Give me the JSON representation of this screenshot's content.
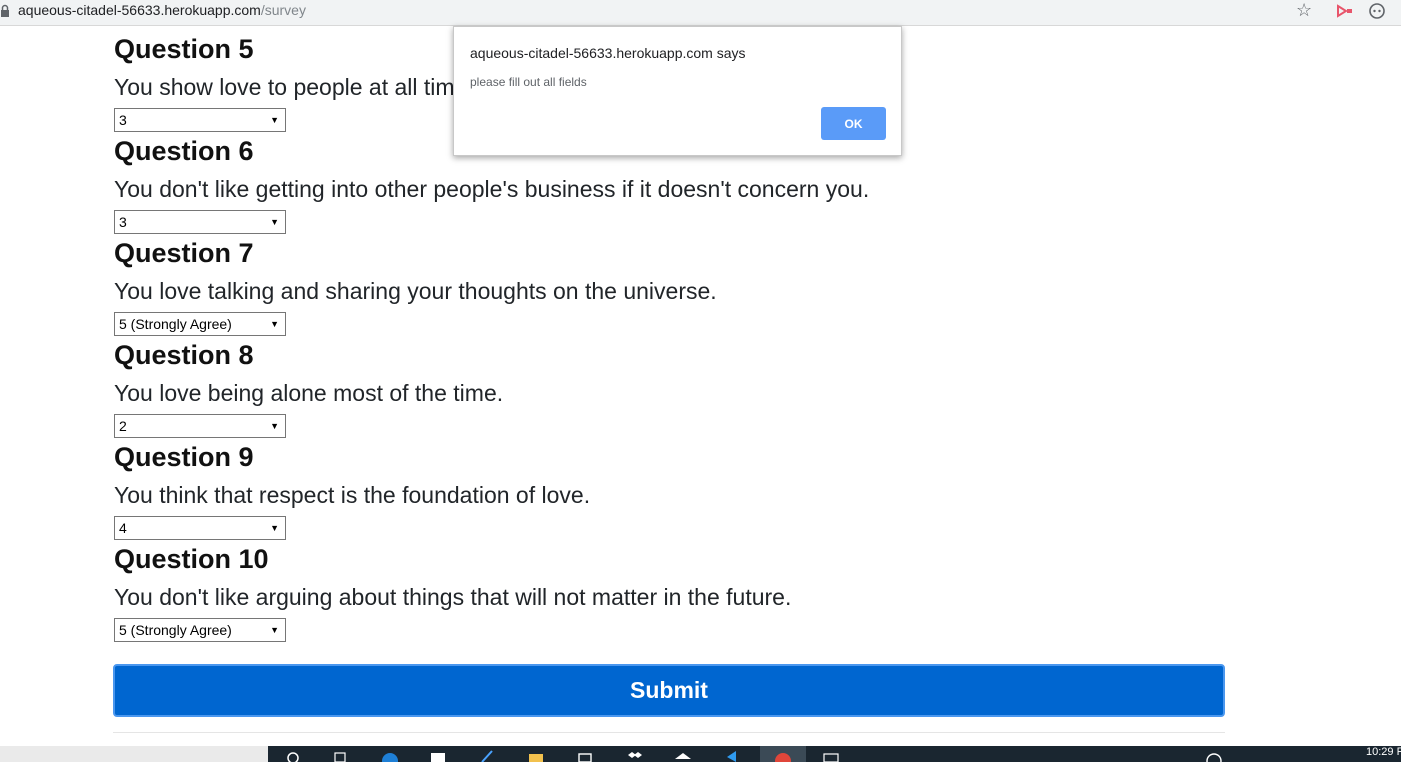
{
  "browser": {
    "url_host": "aqueous-citadel-56633.herokuapp.com",
    "url_path": "/survey"
  },
  "questions": [
    {
      "title": "Question 5",
      "text": "You show love to people at all times.",
      "selected": "3"
    },
    {
      "title": "Question 6",
      "text": "You don't like getting into other people's business if it doesn't concern you.",
      "selected": "3"
    },
    {
      "title": "Question 7",
      "text": "You love talking and sharing your thoughts on the universe.",
      "selected": "5 (Strongly Agree)"
    },
    {
      "title": "Question 8",
      "text": "You love being alone most of the time.",
      "selected": "2"
    },
    {
      "title": "Question 9",
      "text": "You think that respect is the foundation of love.",
      "selected": "4"
    },
    {
      "title": "Question 10",
      "text": "You don't like arguing about things that will not matter in the future.",
      "selected": "5 (Strongly Agree)"
    }
  ],
  "submit_label": "Submit",
  "dialog": {
    "title": "aqueous-citadel-56633.herokuapp.com says",
    "message": "please fill out all fields",
    "ok_label": "OK"
  },
  "taskbar": {
    "clock": "10:29 P"
  },
  "colors": {
    "submit": "#0066d0",
    "dialog_ok": "#5a9bf8"
  }
}
